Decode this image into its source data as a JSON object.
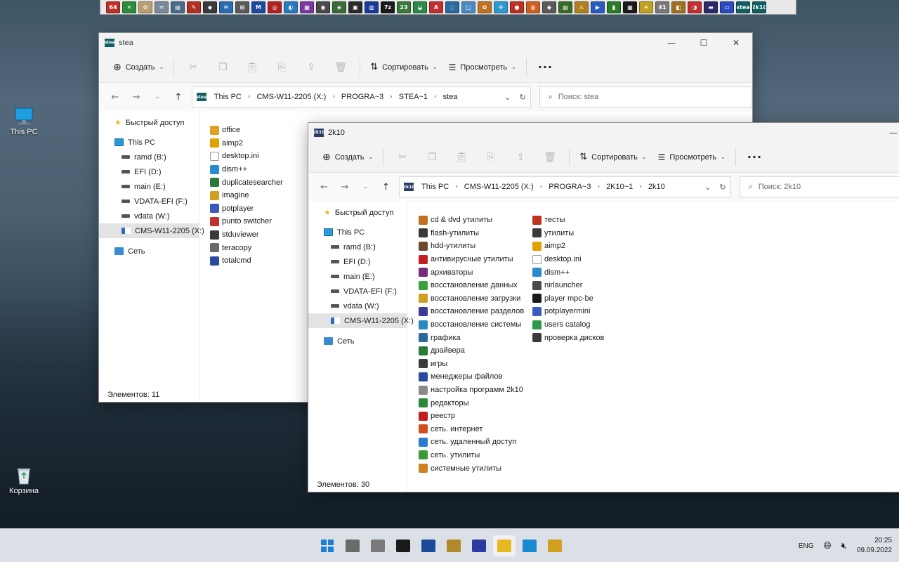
{
  "desktop": {
    "icons": [
      {
        "label": "This PC"
      },
      {
        "label": "Корзина"
      }
    ]
  },
  "launcher": {
    "icons": [
      {
        "name": "total-commander-64",
        "text": "64",
        "color": "#c0302a"
      },
      {
        "name": "green-x",
        "text": "✕",
        "color": "#2e8b3e"
      },
      {
        "name": "tool-a",
        "text": "⚙",
        "color": "#b8a070"
      },
      {
        "name": "tool-b",
        "text": "≈",
        "color": "#7a8a9a"
      },
      {
        "name": "tool-c",
        "text": "▤",
        "color": "#4a6a8a"
      },
      {
        "name": "tool-d",
        "text": "✎",
        "color": "#b03020"
      },
      {
        "name": "tool-e",
        "text": "◆",
        "color": "#3a3a3a"
      },
      {
        "name": "tool-f",
        "text": "✉",
        "color": "#2a6cb0"
      },
      {
        "name": "tool-g",
        "text": "⊞",
        "color": "#5a5a5a"
      },
      {
        "name": "tool-h",
        "text": "M",
        "color": "#1a4aa0"
      },
      {
        "name": "tool-i",
        "text": "◎",
        "color": "#b02020"
      },
      {
        "name": "tool-j",
        "text": "◐",
        "color": "#2a7ac0"
      },
      {
        "name": "tool-k",
        "text": "▦",
        "color": "#7a3aa0"
      },
      {
        "name": "tool-l",
        "text": "◉",
        "color": "#4a4a4a"
      },
      {
        "name": "tool-m",
        "text": "◈",
        "color": "#3a6a3a"
      },
      {
        "name": "tool-n",
        "text": "▣",
        "color": "#2a2a2a"
      },
      {
        "name": "tool-o",
        "text": "▥",
        "color": "#1a3a9a"
      },
      {
        "name": "tool-p",
        "text": "7z",
        "color": "#1a1a1a"
      },
      {
        "name": "tool-q",
        "text": "23",
        "color": "#3a7a3a"
      },
      {
        "name": "tool-r",
        "text": "◒",
        "color": "#2a8a4a"
      },
      {
        "name": "tool-s",
        "text": "A",
        "color": "#c03030"
      },
      {
        "name": "tool-t",
        "text": "◌",
        "color": "#2a6aa0"
      },
      {
        "name": "tool-u",
        "text": "▢",
        "color": "#4a8ac0"
      },
      {
        "name": "tool-v",
        "text": "✿",
        "color": "#c07020"
      },
      {
        "name": "tool-w",
        "text": "✣",
        "color": "#2a9ad0"
      },
      {
        "name": "tool-x",
        "text": "●",
        "color": "#c03020"
      },
      {
        "name": "tool-y",
        "text": "◍",
        "color": "#d06020"
      },
      {
        "name": "tool-z",
        "text": "◆",
        "color": "#5a5a5a"
      },
      {
        "name": "tool-aa",
        "text": "▤",
        "color": "#3a6a2a"
      },
      {
        "name": "tool-ab",
        "text": "⚠",
        "color": "#b08020"
      },
      {
        "name": "tool-ac",
        "text": "▶",
        "color": "#2a5ac0"
      },
      {
        "name": "tool-ad",
        "text": "▮",
        "color": "#2a7a2a"
      },
      {
        "name": "tool-ae",
        "text": "▦",
        "color": "#1a1a1a"
      },
      {
        "name": "tool-af",
        "text": "☀",
        "color": "#c0a020"
      },
      {
        "name": "tool-ag",
        "text": "41",
        "color": "#7a7a7a"
      },
      {
        "name": "tool-ah",
        "text": "◧",
        "color": "#a07020"
      },
      {
        "name": "tool-ai",
        "text": "◑",
        "color": "#c03030"
      },
      {
        "name": "tool-aj",
        "text": "▬",
        "color": "#2a2a6a"
      },
      {
        "name": "tool-ak",
        "text": "▭",
        "color": "#2a4ac0"
      },
      {
        "name": "stea",
        "text": "stea",
        "color": "#0f5f63"
      },
      {
        "name": "2k10",
        "text": "2k10",
        "color": "#0f5f63"
      }
    ]
  },
  "window_stea": {
    "title": "stea",
    "toolbar": {
      "create": "Создать",
      "sort": "Сортировать",
      "view": "Просмотреть"
    },
    "address": {
      "icon_text": "stea",
      "crumbs": [
        "This PC",
        "CMS-W11-2205 (X:)",
        "PROGRA~3",
        "STEA~1",
        "stea"
      ]
    },
    "search_placeholder": "Поиск: stea",
    "nav": [
      {
        "label": "Быстрый доступ",
        "kind": "star"
      },
      {
        "label": "This PC",
        "kind": "pc"
      },
      {
        "label": "ramd (B:)",
        "kind": "drive"
      },
      {
        "label": "EFI (D:)",
        "kind": "drive"
      },
      {
        "label": "main (E:)",
        "kind": "drive"
      },
      {
        "label": "VDATA-EFI (F:)",
        "kind": "drive"
      },
      {
        "label": "vdata (W:)",
        "kind": "drive"
      },
      {
        "label": "CMS-W11-2205 (X:)",
        "kind": "netdrive",
        "selected": true
      },
      {
        "label": "Сеть",
        "kind": "net"
      }
    ],
    "files": [
      {
        "label": "office",
        "color": "#e0a020"
      },
      {
        "label": "aimp2",
        "color": "#e0a000"
      },
      {
        "label": "desktop.ini",
        "color": "#ffffff"
      },
      {
        "label": "dism++",
        "color": "#2a8ad0"
      },
      {
        "label": "duplicatesearcher",
        "color": "#2a7a3a"
      },
      {
        "label": "imagine",
        "color": "#d0a020"
      },
      {
        "label": "potplayer",
        "color": "#3a5ac0"
      },
      {
        "label": "punto switcher",
        "color": "#c03030"
      },
      {
        "label": "stduviewer",
        "color": "#3a3a3a"
      },
      {
        "label": "teracopy",
        "color": "#6a6a6a"
      },
      {
        "label": "totalcmd",
        "color": "#2a4aa0"
      }
    ],
    "status": "Элементов: 11"
  },
  "window_2k10": {
    "title": "2k10",
    "toolbar": {
      "create": "Создать",
      "sort": "Сортировать",
      "view": "Просмотреть"
    },
    "address": {
      "icon_text": "2k10",
      "crumbs": [
        "This PC",
        "CMS-W11-2205 (X:)",
        "PROGRA~3",
        "2K10~1",
        "2k10"
      ]
    },
    "search_placeholder": "Поиск: 2k10",
    "nav": [
      {
        "label": "Быстрый доступ",
        "kind": "star"
      },
      {
        "label": "This PC",
        "kind": "pc"
      },
      {
        "label": "ramd (B:)",
        "kind": "drive"
      },
      {
        "label": "EFI (D:)",
        "kind": "drive"
      },
      {
        "label": "main (E:)",
        "kind": "drive"
      },
      {
        "label": "VDATA-EFI (F:)",
        "kind": "drive"
      },
      {
        "label": "vdata (W:)",
        "kind": "drive"
      },
      {
        "label": "CMS-W11-2205 (X:)",
        "kind": "netdrive",
        "selected": true
      },
      {
        "label": "Сеть",
        "kind": "net"
      }
    ],
    "files_col1": [
      {
        "label": "cd & dvd утилиты",
        "color": "#c07020"
      },
      {
        "label": "flash-утилиты",
        "color": "#3a3a3a"
      },
      {
        "label": "hdd-утилиты",
        "color": "#6a4a2a"
      },
      {
        "label": "антивирусные утилиты",
        "color": "#c02020"
      },
      {
        "label": "архиваторы",
        "color": "#7a2a7a"
      },
      {
        "label": "восстановление данных",
        "color": "#3aa03a"
      },
      {
        "label": "восстановление загрузки",
        "color": "#d0a020"
      },
      {
        "label": "восстановление разделов",
        "color": "#3a3a9a"
      },
      {
        "label": "восстановление системы",
        "color": "#2a8ac0"
      },
      {
        "label": "графика",
        "color": "#2a6aa0"
      },
      {
        "label": "драйвера",
        "color": "#2a7a3a"
      },
      {
        "label": "игры",
        "color": "#3a3a3a"
      },
      {
        "label": "менеджеры файлов",
        "color": "#2a4aa0"
      },
      {
        "label": "настройка программ 2k10",
        "color": "#8a8a8a"
      },
      {
        "label": "редакторы",
        "color": "#2a8a3a"
      },
      {
        "label": "реестр",
        "color": "#c02020"
      },
      {
        "label": "сеть. интернет",
        "color": "#d05020"
      },
      {
        "label": "сеть. удаленный доступ",
        "color": "#2a7ad0"
      },
      {
        "label": "сеть. утилиты",
        "color": "#3a9a3a"
      },
      {
        "label": "системные утилиты",
        "color": "#d08020"
      }
    ],
    "files_col2": [
      {
        "label": "тесты",
        "color": "#c03020"
      },
      {
        "label": "утилиты",
        "color": "#3a3a3a"
      },
      {
        "label": "aimp2",
        "color": "#e0a000"
      },
      {
        "label": "desktop.ini",
        "color": "#ffffff"
      },
      {
        "label": "dism++",
        "color": "#2a8ad0"
      },
      {
        "label": "nirlauncher",
        "color": "#4a4a4a"
      },
      {
        "label": "player mpc-be",
        "color": "#1a1a1a"
      },
      {
        "label": "potplayermini",
        "color": "#3a5ac0"
      },
      {
        "label": "users catalog",
        "color": "#2a9a4a"
      },
      {
        "label": "проверка дисков",
        "color": "#3a3a3a"
      }
    ],
    "status": "Элементов: 30"
  },
  "taskbar": {
    "apps": [
      {
        "name": "start",
        "color": "#1e7fd8",
        "active": false
      },
      {
        "name": "task-view",
        "color": "#6a6a6a",
        "active": false
      },
      {
        "name": "app-a",
        "color": "#7a7a7a",
        "active": false
      },
      {
        "name": "terminal",
        "color": "#1a1a1a",
        "active": false
      },
      {
        "name": "powershell",
        "color": "#1a4a9a",
        "active": false
      },
      {
        "name": "app-b",
        "color": "#b08a2a",
        "active": false
      },
      {
        "name": "save",
        "color": "#2a3aa0",
        "active": false
      },
      {
        "name": "file-explorer",
        "color": "#e8b820",
        "active": true
      },
      {
        "name": "edge",
        "color": "#1a8ad0",
        "active": false
      },
      {
        "name": "app-c",
        "color": "#d0a020",
        "active": false
      }
    ],
    "lang": "ENG",
    "time": "20:25",
    "date": "09.09.2022"
  }
}
